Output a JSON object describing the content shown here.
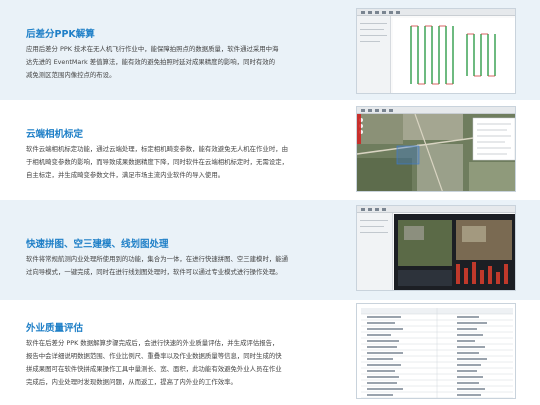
{
  "sections": [
    {
      "title": "后差分PPK解算",
      "lines": [
        "应用后差分 PPK 技术在无人机飞行作业中，能保障拍照点的数据质量，软件通过采用中海",
        "达先进的 EventMark 差值算法，能有效的避免拍照时延对成果精度的影响，同时有效的",
        "减免测区范围内像控点的布设。"
      ]
    },
    {
      "title": "云端相机标定",
      "lines": [
        "软件云端相机标定功能，通过云端处理，标定相机畸变参数，能有效避免无人机在作业时，由",
        "于相机畸变参数的影响，而导致成果数据精度下降，同时软件在云端相机标定时，无需设定，",
        "自主标定，并生成畸变参数文件，满足市场主流内业软件的导入使用。"
      ]
    },
    {
      "title": "快速拼图、空三建模、线划图处理",
      "lines": [
        "软件将常规航测内业处理所使用到的功能，集合为一体，在进行快速拼图、空三建模时，能通",
        "过向导模式，一键完成，同时在进行线划图处理时，软件可以通过专业模式进行操作处理。"
      ]
    },
    {
      "title": "外业质量评估",
      "lines": [
        "软件在后差分 PPK 数据解算步骤完成后，会进行快速的外业质量评估，并生成评估报告，",
        "报告中会详细说明数据范围、作业比例尺、重叠率以及作业数据质量等信息，同时生成的快",
        "拼成果图可在软件快拼成果操作工具中量测长、宽、面积，此功能有效避免外业人员在作业",
        "完成后，内业处理时发现数据问题，从而返工，提高了内外业的工作效率。"
      ]
    }
  ],
  "colors": {
    "title": "#1e7fc7",
    "body": "#444444"
  }
}
